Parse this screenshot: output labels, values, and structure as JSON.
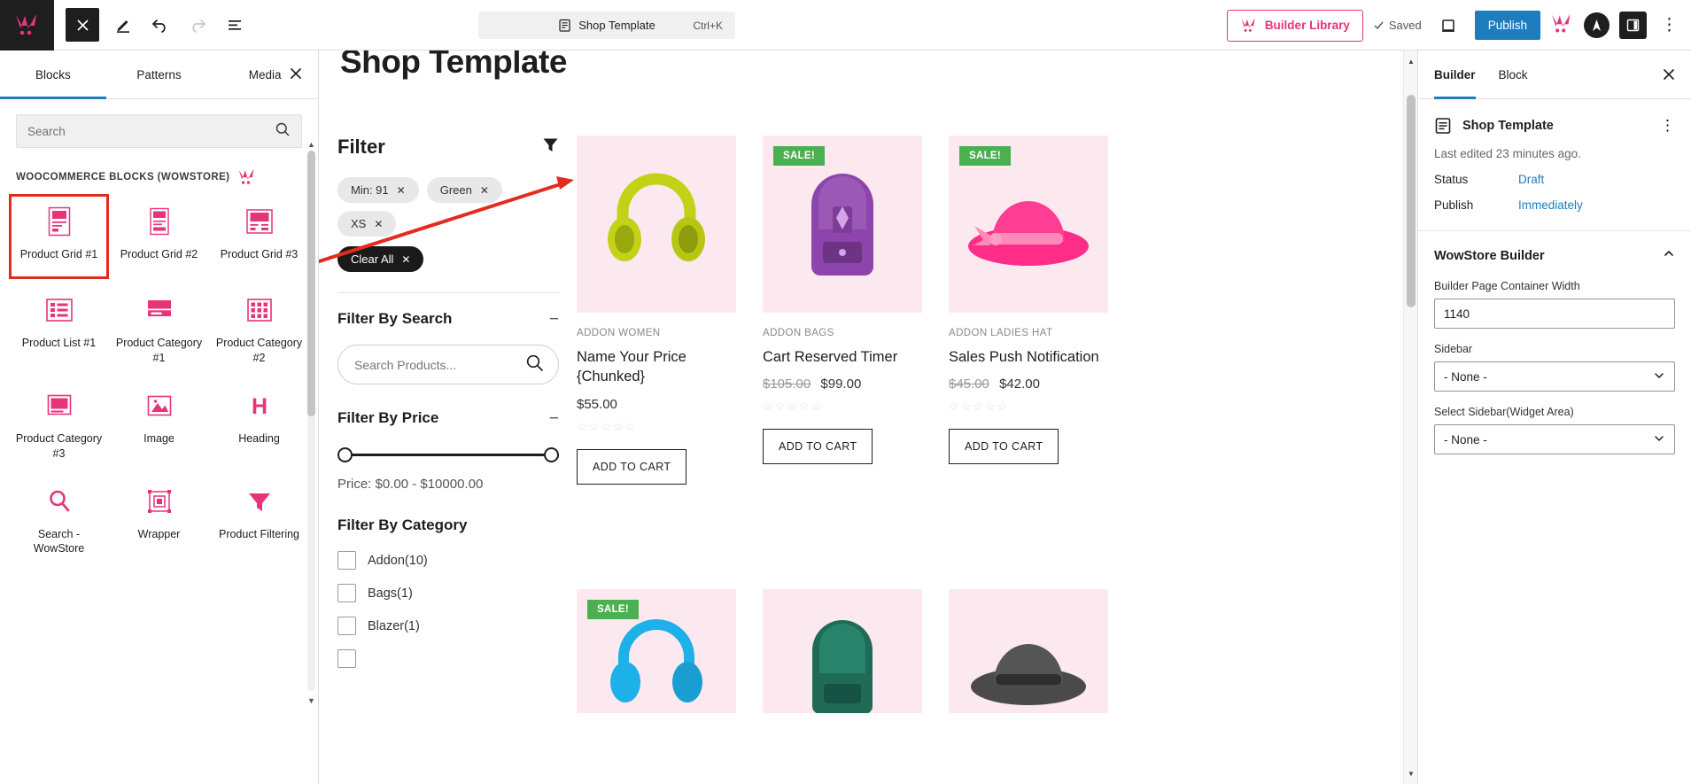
{
  "topbar": {
    "logo_icon": "wowstore-cart-logo",
    "close_icon": "close-icon",
    "edit_icon": "pencil-edit-icon",
    "undo_icon": "undo-icon",
    "redo_icon": "redo-icon",
    "list_view_icon": "list-view-icon",
    "command_bar": {
      "icon": "document-icon",
      "label": "Shop Template",
      "shortcut": "Ctrl+K"
    },
    "builder_library": {
      "label": "Builder Library",
      "icon": "wowstore-cart-logo"
    },
    "saved": {
      "label": "Saved",
      "icon": "check-icon"
    },
    "preview_icon": "desktop-preview-icon",
    "publish_label": "Publish",
    "wow_icon": "wowstore-cart-logo",
    "astra_icon": "astra-logo-icon",
    "settings_panel_icon": "sidebar-toggle-icon",
    "options_icon": "more-options-icon"
  },
  "left_panel": {
    "tabs": [
      {
        "label": "Blocks",
        "active": true
      },
      {
        "label": "Patterns",
        "active": false
      },
      {
        "label": "Media",
        "active": false
      }
    ],
    "close_icon": "close-icon",
    "search": {
      "placeholder": "Search",
      "value": "",
      "icon": "search-icon"
    },
    "section_title": "WOOCOMMERCE BLOCKS (WOWSTORE)",
    "section_brand_icon": "wowstore-cart-logo",
    "blocks": [
      {
        "label": "Product Grid #1",
        "icon": "product-grid-1-icon",
        "highlighted": true
      },
      {
        "label": "Product Grid #2",
        "icon": "product-grid-2-icon",
        "highlighted": false
      },
      {
        "label": "Product Grid #3",
        "icon": "product-grid-3-icon",
        "highlighted": false
      },
      {
        "label": "Product List #1",
        "icon": "product-list-1-icon",
        "highlighted": false
      },
      {
        "label": "Product Category #1",
        "icon": "product-category-1-icon",
        "highlighted": false
      },
      {
        "label": "Product Category #2",
        "icon": "product-category-2-icon",
        "highlighted": false
      },
      {
        "label": "Product Category #3",
        "icon": "product-category-3-icon",
        "highlighted": false
      },
      {
        "label": "Image",
        "icon": "image-icon",
        "highlighted": false
      },
      {
        "label": "Heading",
        "icon": "heading-icon",
        "highlighted": false
      },
      {
        "label": "Search - WowStore",
        "icon": "search-wowstore-icon",
        "highlighted": false
      },
      {
        "label": "Wrapper",
        "icon": "wrapper-icon",
        "highlighted": false
      },
      {
        "label": "Product Filtering",
        "icon": "product-filtering-funnel-icon",
        "highlighted": false
      }
    ]
  },
  "canvas": {
    "page_title": "Shop Template",
    "filter": {
      "title": "Filter",
      "funnel_icon": "funnel-icon",
      "chips": [
        {
          "label": "Min: 91",
          "remove_icon": "close-icon",
          "dark": false
        },
        {
          "label": "Green",
          "remove_icon": "close-icon",
          "dark": false
        },
        {
          "label": "XS",
          "remove_icon": "close-icon",
          "dark": false
        }
      ],
      "clear_all": {
        "label": "Clear All",
        "remove_icon": "close-icon"
      },
      "search_section": {
        "title": "Filter By Search",
        "toggle": "−",
        "placeholder": "Search Products...",
        "value": "",
        "icon": "search-icon"
      },
      "price_section": {
        "title": "Filter By Price",
        "toggle": "−",
        "range_text": "Price: $0.00 - $10000.00",
        "min_pos_pct": 0,
        "max_pos_pct": 100
      },
      "category_section": {
        "title": "Filter By Category",
        "toggle": "",
        "items": [
          {
            "label": "Addon(10)",
            "checked": false
          },
          {
            "label": "Bags(1)",
            "checked": false
          },
          {
            "label": "Blazer(1)",
            "checked": false
          }
        ]
      }
    },
    "products": [
      {
        "badge": "",
        "category": "ADDON  WOMEN",
        "name": "Name Your Price {Chunked}",
        "price": "$55.00",
        "old_price": "",
        "rating": "☆☆☆☆☆",
        "add_to_cart": "ADD TO CART",
        "image_icon": "headphones-product-image",
        "image_color": "#c3d117"
      },
      {
        "badge": "SALE!",
        "category": "ADDON  BAGS",
        "name": "Cart Reserved Timer",
        "price": "$99.00",
        "old_price": "$105.00",
        "rating": "☆☆☆☆☆",
        "add_to_cart": "ADD TO CART",
        "image_icon": "backpack-product-image",
        "image_color": "#8e44ad"
      },
      {
        "badge": "SALE!",
        "category": "ADDON  LADIES HAT",
        "name": "Sales Push Notification",
        "price": "$42.00",
        "old_price": "$45.00",
        "rating": "☆☆☆☆☆",
        "add_to_cart": "ADD TO CART",
        "image_icon": "pink-hat-product-image",
        "image_color": "#ff2d87"
      }
    ],
    "products_row2": [
      {
        "badge": "SALE!",
        "image_icon": "blue-headphones-product-image",
        "image_color": "#1eb0e8"
      },
      {
        "badge": "",
        "image_icon": "green-backpack-product-image",
        "image_color": "#1f6b55"
      },
      {
        "badge": "",
        "image_icon": "grey-hat-product-image",
        "image_color": "#4a4a4a"
      }
    ]
  },
  "right_panel": {
    "tabs": [
      {
        "label": "Builder",
        "active": true
      },
      {
        "label": "Block",
        "active": false
      }
    ],
    "close_icon": "close-icon",
    "document": {
      "icon": "document-icon",
      "title": "Shop Template",
      "kebab_icon": "more-options-icon"
    },
    "last_edited": "Last edited 23 minutes ago.",
    "rows": [
      {
        "label": "Status",
        "value": "Draft"
      },
      {
        "label": "Publish",
        "value": "Immediately"
      }
    ],
    "accordion": {
      "title": "WowStore Builder",
      "chevron_icon": "chevron-up-icon"
    },
    "fields": [
      {
        "type": "input",
        "label": "Builder Page Container Width",
        "value": "1140"
      },
      {
        "type": "select",
        "label": "Sidebar",
        "value": "- None -",
        "chevron_icon": "chevron-down-icon"
      },
      {
        "type": "select",
        "label": "Select Sidebar(Widget Area)",
        "value": "- None -",
        "chevron_icon": "chevron-down-icon"
      }
    ]
  },
  "colors": {
    "brand_pink": "#e6347a",
    "publish_blue": "#1d7dbd",
    "sale_green": "#4caf50",
    "highlight_red": "#e32b20",
    "dark": "#1e1e1e"
  }
}
